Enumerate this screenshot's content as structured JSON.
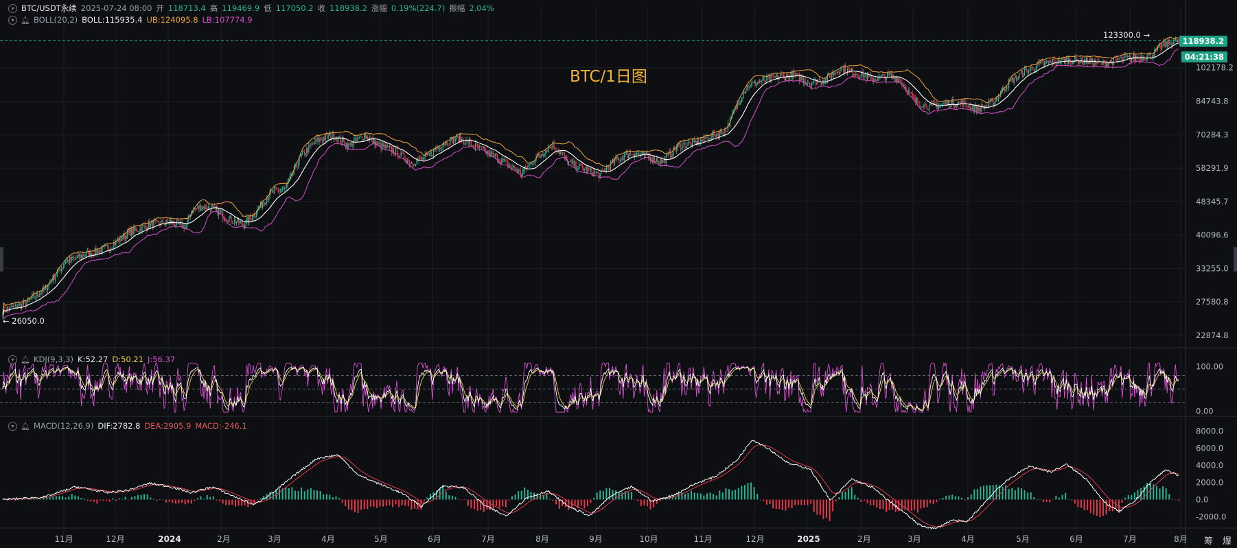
{
  "header": {
    "symbol": "BTC/USDT永续",
    "datetime": "2025-07-24 08:00",
    "open_label": "开",
    "open": "118713.4",
    "high_label": "高",
    "high": "119469.9",
    "low_label": "低",
    "low": "117050.2",
    "close_label": "收",
    "close": "118938.2",
    "change_label": "涨幅",
    "change": "0.19%(224.7)",
    "amp_label": "振幅",
    "amp": "2.04%"
  },
  "boll": {
    "name": "BOLL(20,2)",
    "mid": "BOLL:115935.4",
    "ub": "UB:124095.8",
    "lb": "LB:107774.9"
  },
  "kdj": {
    "name": "KDJ(9,3,3)",
    "k": "K:52.27",
    "d": "D:50.21",
    "j": "J:56.37"
  },
  "macd": {
    "name": "MACD(12,26,9)",
    "dif": "DIF:2782.8",
    "dea": "DEA:2905.9",
    "macd": "MACD:-246.1"
  },
  "chart_title": "BTC/1日图",
  "annotations": {
    "max": "123300.0 →",
    "min": "← 26050.0"
  },
  "price_tags": {
    "last": "118938.2",
    "countdown": "04:21:38"
  },
  "bottom_icons": [
    "筹",
    "爆"
  ],
  "colors": {
    "up": "#26b597",
    "down": "#e5394a",
    "mid": "#ffffff",
    "ub": "#f0a73a",
    "lb": "#d84fd0",
    "k": "#ffffff",
    "d": "#f2d24a",
    "j": "#d84fd0",
    "dif": "#ffffff",
    "dea": "#e5394a",
    "title": "#f2b233",
    "tag": "#1fa386"
  },
  "chart_data": [
    {
      "type": "candlestick",
      "title": "BTC/1日图",
      "x_ticks": [
        "11月",
        "12月",
        "2024",
        "2月",
        "3月",
        "4月",
        "5月",
        "6月",
        "7月",
        "8月",
        "9月",
        "10月",
        "11月",
        "12月",
        "2025",
        "2月",
        "3月",
        "4月",
        "5月",
        "6月",
        "7月",
        "8月"
      ],
      "y_ticks": [
        "102178.2",
        "84743.8",
        "70284.3",
        "58291.9",
        "48345.7",
        "40096.6",
        "33255.0",
        "27580.8",
        "22874.8"
      ],
      "y_scale": "log",
      "ylim": [
        21500,
        128000
      ],
      "trend_points": [
        [
          0,
          26300
        ],
        [
          20,
          27200
        ],
        [
          40,
          29500
        ],
        [
          60,
          34500
        ],
        [
          80,
          36000
        ],
        [
          100,
          37200
        ],
        [
          120,
          40500
        ],
        [
          140,
          42500
        ],
        [
          160,
          43000
        ],
        [
          175,
          42000
        ],
        [
          180,
          46000
        ],
        [
          190,
          47000
        ],
        [
          200,
          46500
        ],
        [
          215,
          44000
        ],
        [
          230,
          42500
        ],
        [
          240,
          45000
        ],
        [
          255,
          50500
        ],
        [
          270,
          52000
        ],
        [
          285,
          62500
        ],
        [
          300,
          68000
        ],
        [
          315,
          70000
        ],
        [
          330,
          66000
        ],
        [
          345,
          70000
        ],
        [
          360,
          66000
        ],
        [
          375,
          64000
        ],
        [
          390,
          60000
        ],
        [
          405,
          62000
        ],
        [
          420,
          67000
        ],
        [
          435,
          69000
        ],
        [
          450,
          66000
        ],
        [
          465,
          63000
        ],
        [
          480,
          60000
        ],
        [
          495,
          56500
        ],
        [
          510,
          62000
        ],
        [
          525,
          66500
        ],
        [
          540,
          60000
        ],
        [
          555,
          58000
        ],
        [
          570,
          56000
        ],
        [
          585,
          61000
        ],
        [
          600,
          63500
        ],
        [
          615,
          62000
        ],
        [
          630,
          60500
        ],
        [
          645,
          66000
        ],
        [
          660,
          67000
        ],
        [
          675,
          69500
        ],
        [
          690,
          72000
        ],
        [
          700,
          82000
        ],
        [
          710,
          92000
        ],
        [
          725,
          95000
        ],
        [
          740,
          97000
        ],
        [
          755,
          98000
        ],
        [
          770,
          94000
        ],
        [
          785,
          96000
        ],
        [
          800,
          102000
        ],
        [
          815,
          99000
        ],
        [
          830,
          96000
        ],
        [
          845,
          97500
        ],
        [
          855,
          96000
        ],
        [
          870,
          85000
        ],
        [
          885,
          82000
        ],
        [
          900,
          83500
        ],
        [
          915,
          84000
        ],
        [
          930,
          81000
        ],
        [
          945,
          84000
        ],
        [
          960,
          94000
        ],
        [
          975,
          100000
        ],
        [
          990,
          104000
        ],
        [
          1005,
          106000
        ],
        [
          1020,
          106500
        ],
        [
          1035,
          106000
        ],
        [
          1050,
          104500
        ],
        [
          1065,
          107000
        ],
        [
          1080,
          108000
        ],
        [
          1095,
          109000
        ],
        [
          1105,
          115000
        ],
        [
          1115,
          118000
        ],
        [
          1122,
          118938
        ]
      ],
      "series": [
        {
          "name": "BOLL",
          "value": "115935.4"
        },
        {
          "name": "UB",
          "value": "124095.8"
        },
        {
          "name": "LB",
          "value": "107774.9"
        }
      ],
      "max_marker": 123300.0,
      "min_marker": 26050.0,
      "last_price": 118938.2
    },
    {
      "type": "line",
      "title": "KDJ(9,3,3)",
      "y_ticks": [
        "100.00",
        "0.00"
      ],
      "ylim": [
        -5,
        110
      ],
      "series": [
        {
          "name": "K",
          "value": 52.27
        },
        {
          "name": "D",
          "value": 50.21
        },
        {
          "name": "J",
          "value": 56.37
        }
      ]
    },
    {
      "type": "bar",
      "title": "MACD(12,26,9)",
      "y_ticks": [
        "8000.0",
        "6000.0",
        "4000.0",
        "2000.0",
        "0.0",
        "-2000.0"
      ],
      "ylim": [
        -3000,
        8500
      ],
      "dif_points": [
        [
          0,
          0
        ],
        [
          40,
          300
        ],
        [
          70,
          1500
        ],
        [
          100,
          800
        ],
        [
          120,
          1100
        ],
        [
          140,
          1900
        ],
        [
          160,
          1500
        ],
        [
          180,
          800
        ],
        [
          200,
          1500
        ],
        [
          220,
          400
        ],
        [
          240,
          -600
        ],
        [
          260,
          1000
        ],
        [
          280,
          3000
        ],
        [
          300,
          4800
        ],
        [
          320,
          5200
        ],
        [
          340,
          2800
        ],
        [
          360,
          1800
        ],
        [
          380,
          800
        ],
        [
          400,
          -800
        ],
        [
          420,
          1600
        ],
        [
          440,
          1400
        ],
        [
          460,
          -700
        ],
        [
          480,
          -1900
        ],
        [
          500,
          200
        ],
        [
          520,
          1000
        ],
        [
          540,
          -800
        ],
        [
          560,
          -1900
        ],
        [
          580,
          400
        ],
        [
          600,
          1500
        ],
        [
          620,
          -200
        ],
        [
          640,
          500
        ],
        [
          660,
          1800
        ],
        [
          680,
          2700
        ],
        [
          700,
          4500
        ],
        [
          715,
          7000
        ],
        [
          730,
          6000
        ],
        [
          750,
          4200
        ],
        [
          770,
          3600
        ],
        [
          790,
          -100
        ],
        [
          810,
          2400
        ],
        [
          830,
          1400
        ],
        [
          845,
          -100
        ],
        [
          860,
          -1500
        ],
        [
          875,
          -3000
        ],
        [
          890,
          -3400
        ],
        [
          905,
          -2400
        ],
        [
          920,
          -2600
        ],
        [
          935,
          -600
        ],
        [
          950,
          1400
        ],
        [
          965,
          2800
        ],
        [
          980,
          3900
        ],
        [
          1000,
          3200
        ],
        [
          1015,
          4100
        ],
        [
          1035,
          2300
        ],
        [
          1050,
          -200
        ],
        [
          1065,
          -1400
        ],
        [
          1080,
          -200
        ],
        [
          1095,
          2000
        ],
        [
          1110,
          3500
        ],
        [
          1122,
          2783
        ]
      ],
      "series": [
        {
          "name": "DIF",
          "value": 2782.8
        },
        {
          "name": "DEA",
          "value": 2905.9
        },
        {
          "name": "MACD",
          "value": -246.1
        }
      ]
    }
  ]
}
